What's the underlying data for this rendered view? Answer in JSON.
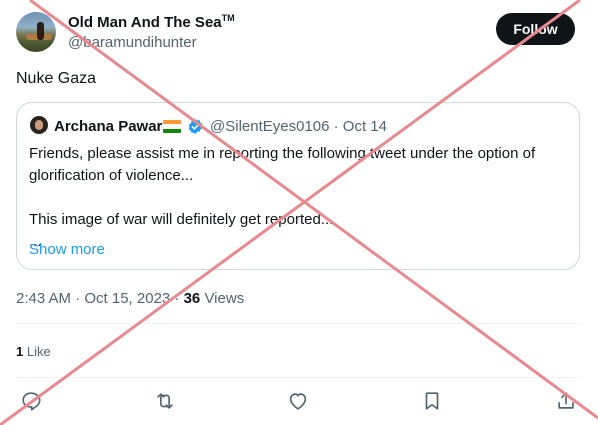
{
  "author": {
    "name": "Old Man And The Sea",
    "tm": "TM",
    "handle": "@baramundihunter"
  },
  "follow_label": "Follow",
  "tweet_text": "Nuke Gaza",
  "quote": {
    "name": "Archana Pawar",
    "handle_date": "@SilentEyes0106 · Oct 14",
    "lines": [
      "Friends, please assist me in reporting the following tweet under the option of",
      "glorification of violence...",
      "",
      "This image of war will definitely get reported...",
      "..."
    ],
    "show_more": "Show more"
  },
  "timestamp": "2:43 AM · Oct 15, 2023 · ",
  "views_count": "36",
  "views_label": "Views",
  "likes_count": "1",
  "likes_label": "Like",
  "colors": {
    "accent": "#1d9bf0",
    "text": "#0f1419",
    "muted": "#536471",
    "overlay_x": "#e8898d"
  },
  "icons": [
    "reply-icon",
    "retweet-icon",
    "like-icon",
    "bookmark-icon",
    "share-icon",
    "verified-badge-icon",
    "india-flag-icon"
  ]
}
